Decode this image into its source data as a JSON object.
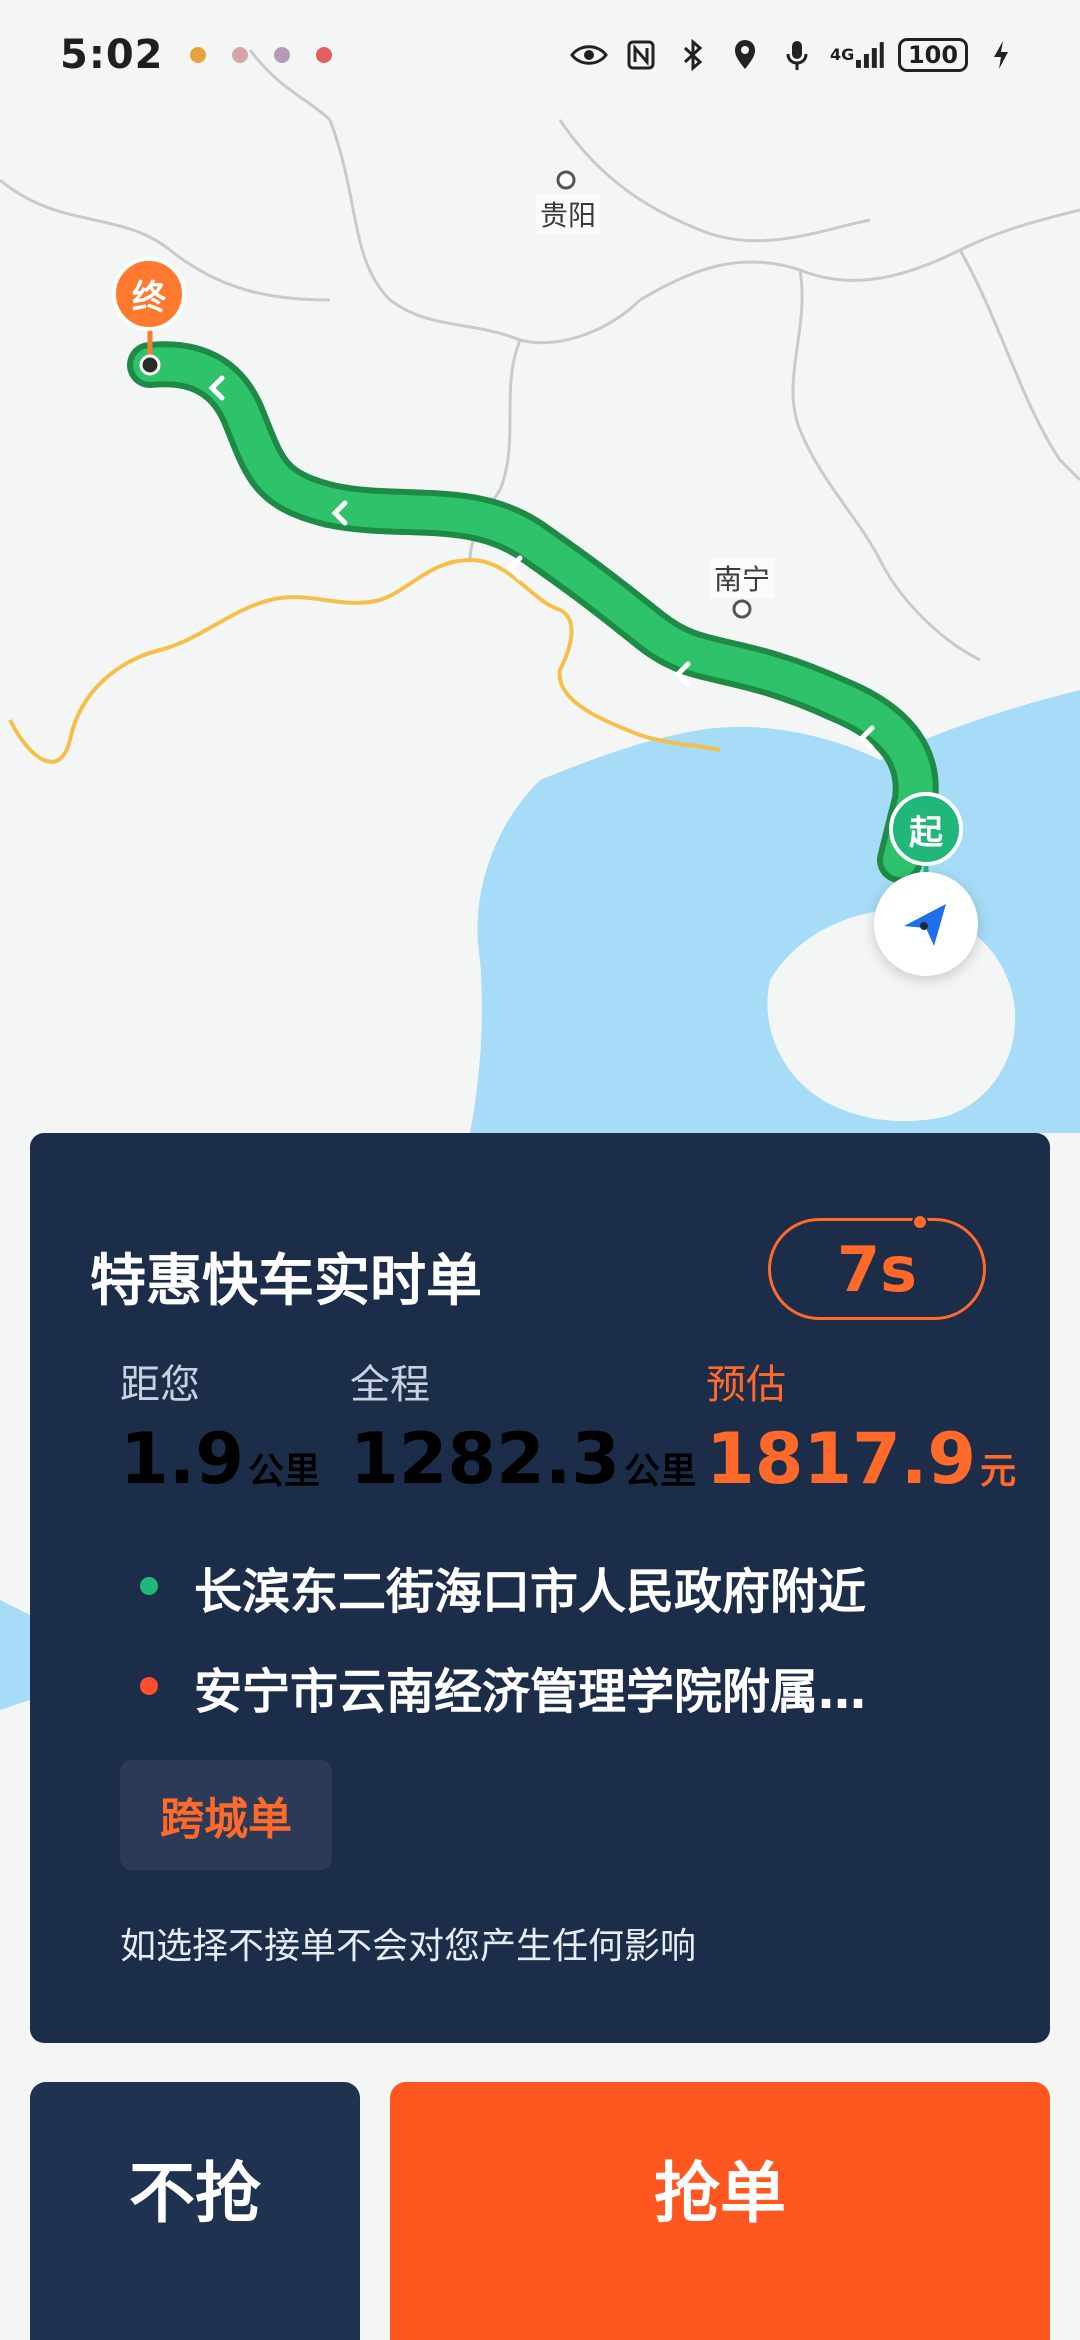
{
  "status_bar": {
    "time": "5:02",
    "battery": "100",
    "network": "4G"
  },
  "map": {
    "cities": [
      {
        "name": "贵阳"
      },
      {
        "name": "南宁"
      }
    ],
    "end_marker": "终",
    "start_marker": "起",
    "colors": {
      "route": "#2ec26a",
      "route_outline": "#1e8a46",
      "sea": "#a6dcf7",
      "land": "#f4f6f5",
      "border_province": "#c7cbd0",
      "border_country": "#f5c04a",
      "end_marker": "#ff7a2e",
      "start_marker": "#21b67a",
      "locator_arrow": "#1f6feb"
    }
  },
  "order": {
    "title": "特惠快车实时单",
    "countdown": "7s",
    "stats": {
      "distance": {
        "label": "距您",
        "value": "1.9",
        "unit": "公里"
      },
      "trip": {
        "label": "全程",
        "value": "1282.3",
        "unit": "公里"
      },
      "estimate": {
        "label": "预估",
        "value": "1817.9",
        "unit": "元"
      }
    },
    "pickup": "长滨东二街海口市人民政府附近",
    "dropoff": "安宁市云南经济管理学院附属…",
    "tag": "跨城单",
    "notice": "如选择不接单不会对您产生任何影响",
    "colors": {
      "card_bg": "#1c2d4a",
      "accent": "#ff6a2a",
      "pickup_dot": "#21b67a",
      "dropoff_dot": "#ff4d2e"
    }
  },
  "actions": {
    "skip_label": "不抢",
    "grab_label": "抢单"
  }
}
